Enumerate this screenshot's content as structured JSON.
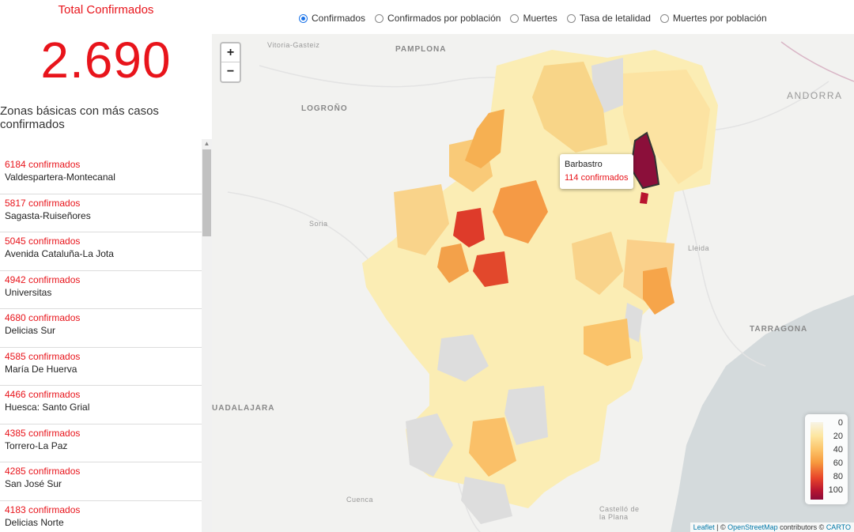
{
  "header": {
    "total_title": "Total Confirmados",
    "total_value": "2.690"
  },
  "zones": {
    "title": "Zonas básicas con más casos confirmados",
    "items": [
      {
        "count": "6184 confirmados",
        "name": "Valdespartera-Montecanal"
      },
      {
        "count": "5817 confirmados",
        "name": "Sagasta-Ruiseñores"
      },
      {
        "count": "5045 confirmados",
        "name": "Avenida Cataluña-La Jota"
      },
      {
        "count": "4942 confirmados",
        "name": "Universitas"
      },
      {
        "count": "4680 confirmados",
        "name": "Delicias Sur"
      },
      {
        "count": "4585 confirmados",
        "name": "María De Huerva"
      },
      {
        "count": "4466 confirmados",
        "name": "Huesca: Santo Grial"
      },
      {
        "count": "4385 confirmados",
        "name": "Torrero-La Paz"
      },
      {
        "count": "4285 confirmados",
        "name": "San José Sur"
      },
      {
        "count": "4183 confirmados",
        "name": "Delicias Norte"
      }
    ]
  },
  "radio": {
    "options": [
      "Confirmados",
      "Confirmados por población",
      "Muertes",
      "Tasa de letalidad",
      "Muertes por población"
    ],
    "selected": "Confirmados"
  },
  "map": {
    "zoom_in": "+",
    "zoom_out": "−",
    "places": {
      "vitoria": "Vitoria-Gasteiz",
      "pamplona": "PAMPLONA",
      "logrono": "LOGROÑO",
      "andorra": "ANDORRA",
      "soria": "Soria",
      "lleida": "Lleida",
      "tarragona": "TARRAGONA",
      "guadalajara": "UADALAJARA",
      "cuenca": "Cuenca",
      "castellon": "Castelló de la Plana"
    },
    "tooltip": {
      "name": "Barbastro",
      "count": "114 confirmados"
    },
    "legend": [
      "0",
      "20",
      "40",
      "60",
      "80",
      "100"
    ],
    "attribution": {
      "leaflet": "Leaflet",
      "sep": " | © ",
      "osm": "OpenStreetMap",
      "contrib": " contributors © ",
      "carto": "CARTO"
    }
  },
  "colors": {
    "accent": "#e8141b",
    "radio_selected": "#1a73e8"
  }
}
